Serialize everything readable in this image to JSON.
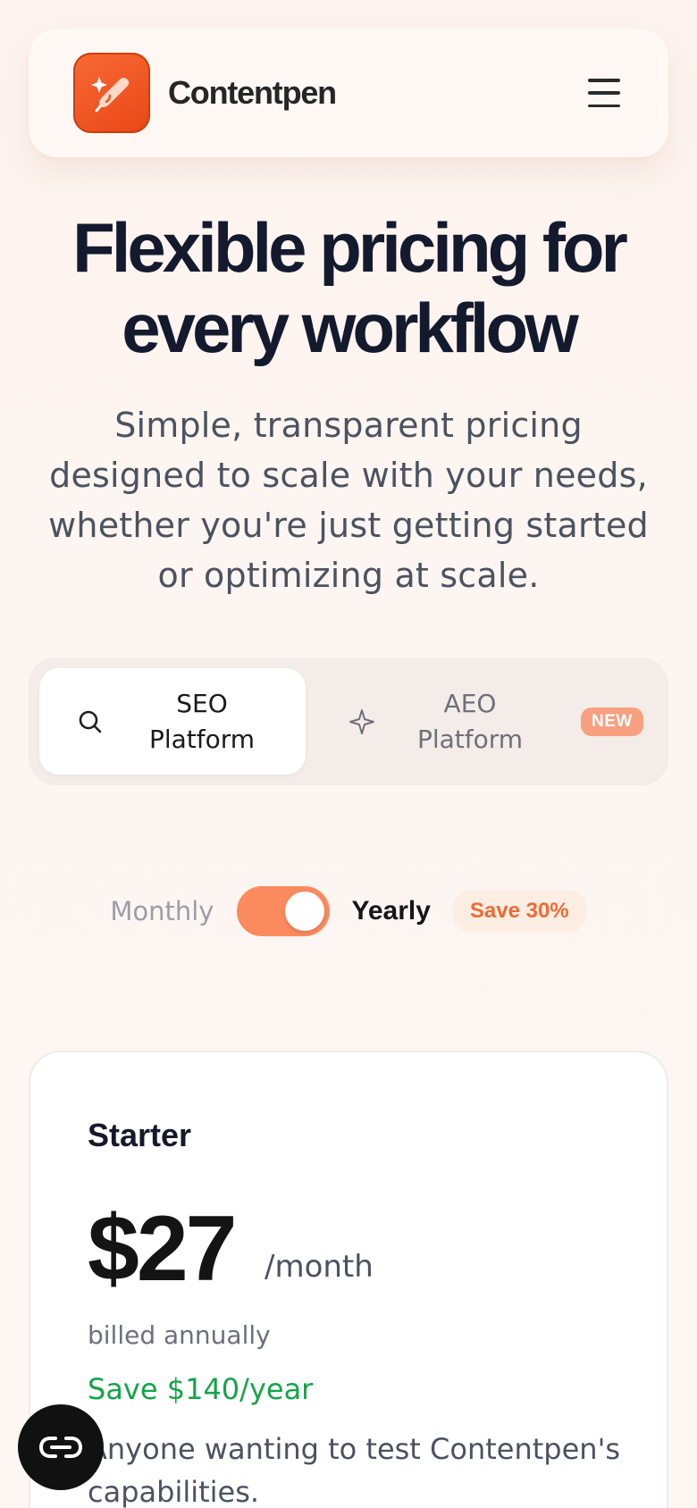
{
  "header": {
    "brand": "Contentpen",
    "logo_icon": "sparkle-pen-icon",
    "menu_icon": "hamburger-menu-icon"
  },
  "hero": {
    "title_line1": "Flexible pricing for",
    "title_line2": "every workflow",
    "subtitle": "Simple, transparent pricing designed to scale with your needs, whether you're just getting started or optimizing at scale."
  },
  "platform_tabs": [
    {
      "label_line1": "SEO",
      "label_line2": "Platform",
      "icon": "search-icon",
      "active": true
    },
    {
      "label_line1": "AEO",
      "label_line2": "Platform",
      "icon": "sparkle-icon",
      "active": false,
      "badge": "NEW"
    }
  ],
  "billing": {
    "monthly_label": "Monthly",
    "yearly_label": "Yearly",
    "selected": "Yearly",
    "save_badge": "Save 30%"
  },
  "plans": [
    {
      "name": "Starter",
      "price": "$27",
      "period": "/month",
      "billed_note": "billed annually",
      "savings": "Save $140/year",
      "description": "Anyone wanting to test Contentpen's capabilities."
    }
  ],
  "chat_widget": {
    "icon": "chat-link-icon"
  },
  "colors": {
    "accent": "#f86a36",
    "toggle": "#fb8a5f",
    "savings_green": "#16a34a",
    "heading": "#141a2e"
  }
}
